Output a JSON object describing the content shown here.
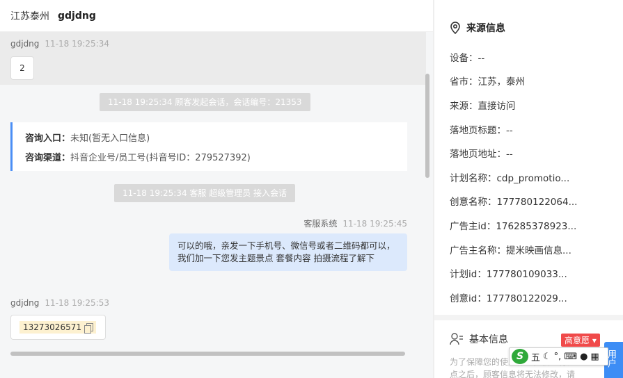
{
  "header": {
    "location": "江苏泰州",
    "visitor": "gdjdng"
  },
  "messages": {
    "first": {
      "sender": "gdjdng",
      "time": "11-18 19:25:34",
      "text": "2"
    },
    "sys1": "11-18 19:25:34 顾客发起会话，会话编号：21353",
    "info": {
      "entry_label": "咨询入口：",
      "entry_value": "未知(暂无入口信息)",
      "channel_label": "咨询渠道：",
      "channel_value": "抖音企业号/员工号(抖音号ID：279527392)"
    },
    "sys2": "11-18 19:25:34 客服 超级管理员 接入会话",
    "agent": {
      "sender": "客服系统",
      "time": "11-18 19:25:45",
      "text": "可以的哦，亲发一下手机号、微信号或者二维码都可以，我们加一下您发主题景点 套餐内容 拍摄流程了解下"
    },
    "last": {
      "sender": "gdjdng",
      "time": "11-18 19:25:53",
      "phone": "13273026571"
    }
  },
  "source": {
    "title": "来源信息",
    "fields": [
      "设备：--",
      "省市：江苏，泰州",
      "来源：直接访问",
      "落地页标题：--",
      "落地页地址：--",
      "计划名称：cdp_promotio...",
      "创意名称：177780122064...",
      "广告主id：176285378923...",
      "广告主名称：提米映画信息...",
      "计划id：177780109033...",
      "创意id：177780122029..."
    ]
  },
  "basic": {
    "title": "基本信息",
    "badge": "高意愿",
    "notice": "为了保障您的使用体验，信息将在的24点之后，顾客信息将无法修改，请",
    "side_button": "用户"
  },
  "ime": {
    "logo": "S",
    "mode": "五"
  }
}
